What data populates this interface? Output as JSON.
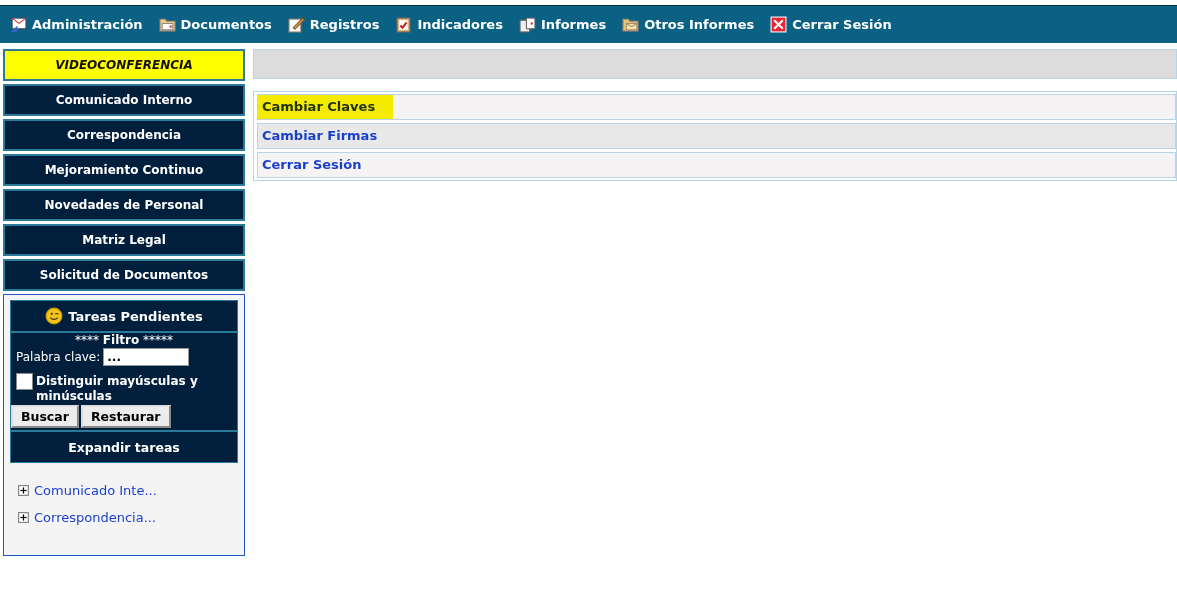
{
  "top_menu": [
    {
      "label": "Administración"
    },
    {
      "label": "Documentos"
    },
    {
      "label": "Registros"
    },
    {
      "label": "Indicadores"
    },
    {
      "label": "Informes"
    },
    {
      "label": "Otros Informes"
    },
    {
      "label": "Cerrar Sesión"
    }
  ],
  "sidebar": {
    "items": [
      {
        "label": "VIDEOCONFERENCIA",
        "selected": true
      },
      {
        "label": "Comunicado Interno",
        "selected": false
      },
      {
        "label": "Correspondencia",
        "selected": false
      },
      {
        "label": "Mejoramiento Continuo",
        "selected": false
      },
      {
        "label": "Novedades de Personal",
        "selected": false
      },
      {
        "label": "Matriz Legal",
        "selected": false
      },
      {
        "label": "Solicitud de Documentos",
        "selected": false
      }
    ],
    "tasks": {
      "title": "Tareas Pendientes",
      "filter_prefix": "****",
      "filter_title": "Filtro",
      "filter_suffix": "*****",
      "keyword_label": "Palabra clave:",
      "keyword_value": "...",
      "case_checkbox": {
        "label": "Distinguir mayúsculas y minúsculas",
        "checked": false
      },
      "buttons": [
        "Buscar",
        "Restaurar"
      ],
      "expand": "Expandir tareas",
      "tree": [
        {
          "label": "Comunicado Inte...",
          "expanded": false
        },
        {
          "label": "Correspondencia...",
          "expanded": false
        }
      ]
    }
  },
  "options": [
    {
      "label": "Cambiar Claves",
      "highlighted": true
    },
    {
      "label": "Cambiar Firmas",
      "highlighted": false
    },
    {
      "label": "Cerrar Sesión",
      "highlighted": false
    }
  ]
}
